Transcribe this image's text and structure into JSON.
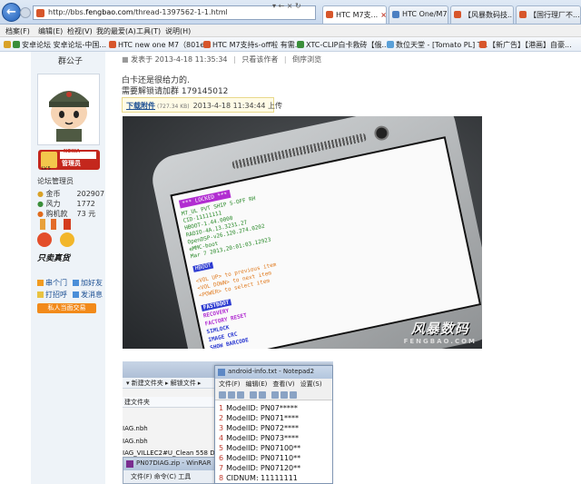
{
  "browser": {
    "url_prefix": "http://bbs.",
    "url_domain": "fengbao.com",
    "url_path": "/thread-1397562-1-1.html",
    "addr_buttons": "▾ ← × ↻",
    "tabs": [
      {
        "label": "HTC M7支...",
        "active": true
      },
      {
        "label": "HTC One/M7..."
      },
      {
        "label": "【风暴数码技..."
      },
      {
        "label": "【国行理厂不..."
      }
    ],
    "tab_close": "×",
    "menu": [
      "档案(F)",
      "编辑(E)",
      "检视(V)",
      "我的最爱(A)",
      "工具(T)",
      "说明(H)"
    ],
    "favorites": [
      "安卓论坛 安卓论坛-中国...",
      "HTC new one M7（801e...",
      "HTC M7支持s-off啦 有需...",
      "XTC-CLIP白卡救砖【俄...",
      "数位天堂 - [Tomato PL] T...",
      "【新广告】【港画】自豪..."
    ]
  },
  "user": {
    "name": "群公子",
    "badge_top": "NOKIA",
    "badge_main": "管理员",
    "level": "LV.5",
    "role": "论坛管理员",
    "stats": [
      {
        "label": "金币",
        "value": "202907"
      },
      {
        "label": "风力",
        "value": "1772"
      },
      {
        "label": "购机款",
        "value": "73 元"
      }
    ],
    "shop_badge": "只卖真货",
    "links": [
      "串个门",
      "加好友",
      "打招呼",
      "发消息"
    ],
    "pm_button": "私人当面交易"
  },
  "post": {
    "posted_label": "发表于 2013-4-18 11:35:34",
    "only_author": "只看该作者",
    "reverse": "倒序浏览",
    "sep": "|",
    "line1": "白卡还是很给力的.",
    "line2": "需要解锁请加群  179145012",
    "attach_link": "下载附件",
    "attach_size": "(727.34 KB)",
    "attach_date": "2013-4-18 11:34:44 上传"
  },
  "bootloader": {
    "header": "*** LOCKED ***",
    "lines": [
      "M7_UL PVT SHIP S-OFF RH",
      "CID-11111111",
      "HBOOT-1.44.0000",
      "RADIO-4A.13.3231.27",
      "OpenDSP-v26.120.274.0202",
      "eMMC-boot",
      "Mar  7 2013,20:01:03.12923"
    ],
    "selected": "HBOOT",
    "hints": [
      "<VOL UP> to previous item",
      "<VOL DOWN> to next item",
      "<POWER> to select item"
    ],
    "menu": [
      {
        "label": "FASTBOOT",
        "color": "#ffffff",
        "bg": "#2d3bd1"
      },
      {
        "label": "RECOVERY",
        "color": "#b12dd1"
      },
      {
        "label": "FACTORY RESET",
        "color": "#b12dd1"
      },
      {
        "label": "SIMLOCK",
        "color": "#2d3bd1"
      },
      {
        "label": "IMAGE CRC",
        "color": "#2d3bd1"
      },
      {
        "label": "SHOW BARCODE",
        "color": "#2d3bd1"
      }
    ],
    "watermark_main": "风暴数码",
    "watermark_sub": "FENGBAO.COM"
  },
  "explorer": {
    "toolbar": "▾  新建文件夹  ▸  解锁文件  ▸",
    "column": "建文件夹",
    "files": [
      "IAG.nbh",
      "IAG.nbh",
      "IAG_VILLEC2#U_Clean 558 Data R"
    ],
    "winrar_title": "PN07DIAG.zip - WinRAR",
    "winrar_menu": "文件(F)   命令(C)   工具"
  },
  "notepad": {
    "title": "android-info.txt - Notepad2",
    "menu": [
      "文件(F)",
      "编辑(E)",
      "查看(V)",
      "设置(S)"
    ],
    "lines": [
      {
        "n": "1",
        "text": "ModelID: PN07*****"
      },
      {
        "n": "2",
        "text": "ModelID: PN071****"
      },
      {
        "n": "3",
        "text": "ModelID: PN072****"
      },
      {
        "n": "4",
        "text": "ModelID: PN073****"
      },
      {
        "n": "5",
        "text": "ModelID: PN07100**"
      },
      {
        "n": "6",
        "text": "ModelID: PN07110**"
      },
      {
        "n": "7",
        "text": "ModelID: PN07120**"
      },
      {
        "n": "8",
        "text": "CIDNUM: 11111111"
      }
    ]
  }
}
